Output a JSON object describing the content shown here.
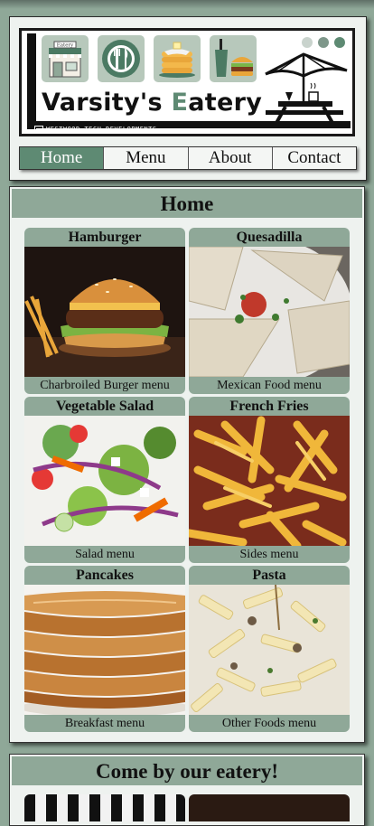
{
  "brand": {
    "name_part1": "Varsity's ",
    "name_accent": "E",
    "name_part2": "atery",
    "tagline": "WESTWOOD TECH DEVELOPMENTS",
    "storefront_sign": "Eatery",
    "colors": {
      "accent": "#5e8a73",
      "background": "#8fa898",
      "panel": "#eef2ef"
    }
  },
  "banner_icons": [
    "storefront-icon",
    "plate-utensils-icon",
    "pancakes-icon",
    "soda-burger-icon",
    "picnic-umbrella-icon"
  ],
  "nav": {
    "items": [
      {
        "label": "Home",
        "active": true
      },
      {
        "label": "Menu",
        "active": false
      },
      {
        "label": "About",
        "active": false
      },
      {
        "label": "Contact",
        "active": false
      }
    ]
  },
  "home": {
    "title": "Home",
    "cards": [
      {
        "title": "Hamburger",
        "caption": "Charbroiled Burger menu"
      },
      {
        "title": "Quesadilla",
        "caption": "Mexican Food menu"
      },
      {
        "title": "Vegetable Salad",
        "caption": "Salad menu"
      },
      {
        "title": "French Fries",
        "caption": "Sides menu"
      },
      {
        "title": "Pancakes",
        "caption": "Breakfast menu"
      },
      {
        "title": "Pasta",
        "caption": "Other Foods menu"
      }
    ]
  },
  "visit": {
    "title": "Come by our eatery!"
  }
}
